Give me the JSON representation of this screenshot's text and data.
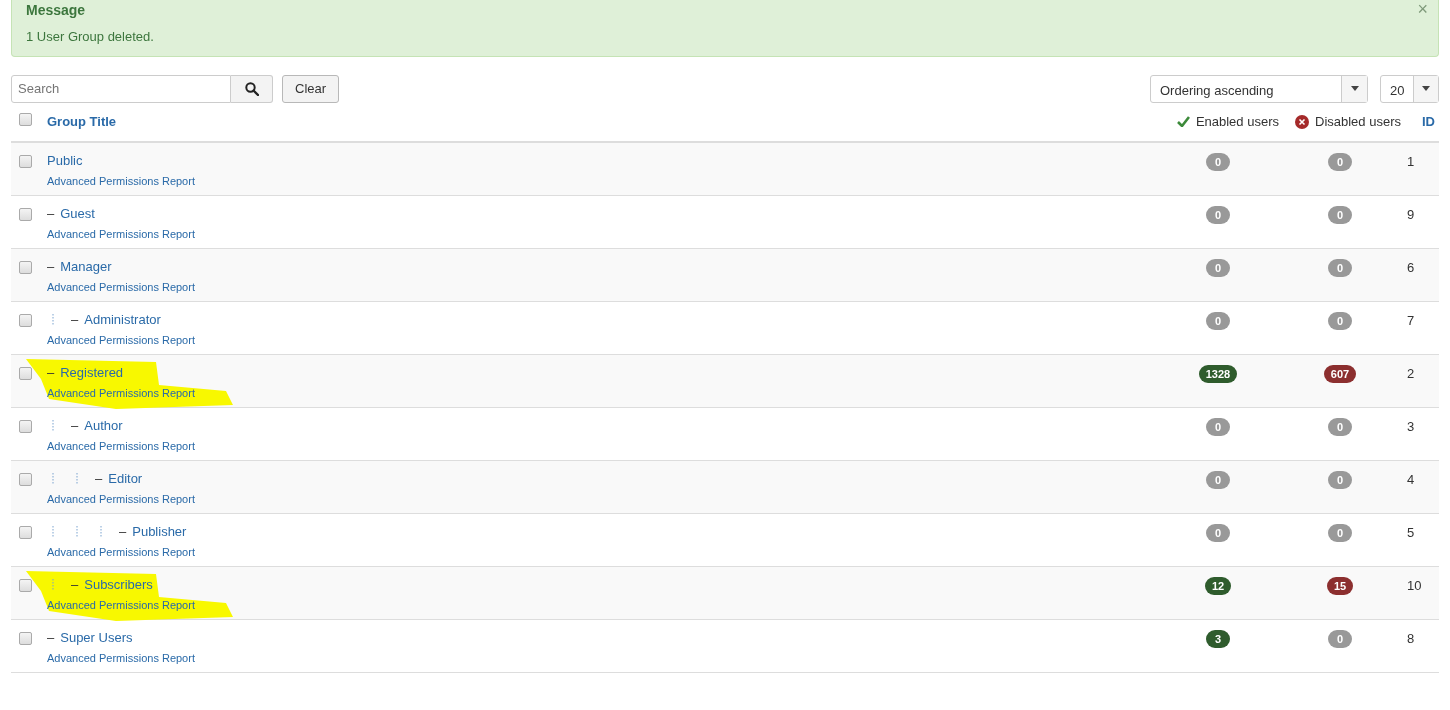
{
  "message": {
    "heading": "Message",
    "text": "1 User Group deleted.",
    "close": "×"
  },
  "toolbar": {
    "search": {
      "placeholder": "Search"
    },
    "clear_button": "Clear",
    "ordering": "Ordering ascending",
    "limit": "20"
  },
  "table": {
    "columns": {
      "title": "Group Title",
      "enabled": "Enabled users",
      "disabled": "Disabled users",
      "id": "ID"
    },
    "select_all_checked": false,
    "rows": [
      {
        "title": "Public",
        "report": "Advanced Permissions Report",
        "enabled": {
          "count": "0",
          "nonzero": false
        },
        "disabled": {
          "count": "0",
          "nonzero": false
        },
        "id": "1",
        "checked": false,
        "highlighted": false,
        "children": [
          {
            "dash": "–",
            "title": "Guest",
            "report": "Advanced Permissions Report",
            "enabled": {
              "count": "0",
              "nonzero": false
            },
            "disabled": {
              "count": "0",
              "nonzero": false
            },
            "id": "9",
            "checked": false,
            "highlighted": false
          },
          {
            "dash": "–",
            "title": "Manager",
            "report": "Advanced Permissions Report",
            "enabled": {
              "count": "0",
              "nonzero": false
            },
            "disabled": {
              "count": "0",
              "nonzero": false
            },
            "id": "6",
            "checked": false,
            "highlighted": false,
            "children": [
              {
                "dash": "–",
                "title": "Administrator",
                "report": "Advanced Permissions Report",
                "enabled": {
                  "count": "0",
                  "nonzero": false
                },
                "disabled": {
                  "count": "0",
                  "nonzero": false
                },
                "id": "7",
                "checked": false,
                "highlighted": false
              }
            ]
          },
          {
            "dash": "–",
            "title": "Registered",
            "report": "Advanced Permissions Report",
            "enabled": {
              "count": "1328",
              "nonzero": true
            },
            "disabled": {
              "count": "607",
              "nonzero": true
            },
            "id": "2",
            "checked": false,
            "highlighted": true,
            "children": [
              {
                "dash": "–",
                "title": "Author",
                "report": "Advanced Permissions Report",
                "enabled": {
                  "count": "0",
                  "nonzero": false
                },
                "disabled": {
                  "count": "0",
                  "nonzero": false
                },
                "id": "3",
                "checked": false,
                "highlighted": false,
                "children": [
                  {
                    "dash": "–",
                    "title": "Editor",
                    "report": "Advanced Permissions Report",
                    "enabled": {
                      "count": "0",
                      "nonzero": false
                    },
                    "disabled": {
                      "count": "0",
                      "nonzero": false
                    },
                    "id": "4",
                    "checked": false,
                    "highlighted": false,
                    "children": [
                      {
                        "dash": "–",
                        "title": "Publisher",
                        "report": "Advanced Permissions Report",
                        "enabled": {
                          "count": "0",
                          "nonzero": false
                        },
                        "disabled": {
                          "count": "0",
                          "nonzero": false
                        },
                        "id": "5",
                        "checked": false,
                        "highlighted": false
                      }
                    ]
                  }
                ]
              },
              {
                "dash": "–",
                "title": "Subscribers",
                "report": "Advanced Permissions Report",
                "enabled": {
                  "count": "12",
                  "nonzero": true
                },
                "disabled": {
                  "count": "15",
                  "nonzero": true
                },
                "id": "10",
                "checked": false,
                "highlighted": true
              }
            ]
          },
          {
            "dash": "–",
            "title": "Super Users",
            "report": "Advanced Permissions Report",
            "enabled": {
              "count": "3",
              "nonzero": true
            },
            "disabled": {
              "count": "0",
              "nonzero": false
            },
            "id": "8",
            "checked": false,
            "highlighted": false
          }
        ]
      }
    ]
  }
}
